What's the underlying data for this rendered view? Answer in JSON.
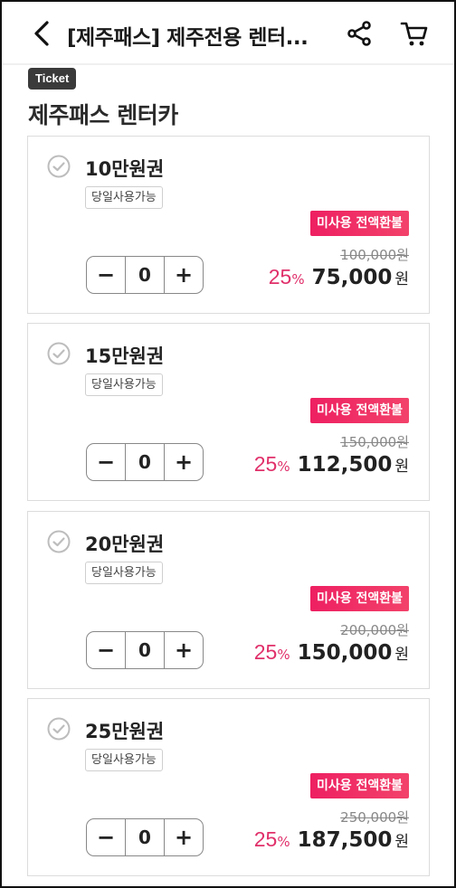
{
  "header": {
    "title": "[제주패스] 제주전용 렌터...",
    "back_icon": "chevron-left-icon",
    "share_icon": "share-icon",
    "cart_icon": "cart-icon"
  },
  "ticket_label": "Ticket",
  "section_title": "제주패스 렌터카",
  "products": [
    {
      "name": "10만원권",
      "tag": "당일사용가능",
      "refund_label": "미사용 전액환불",
      "original_price": "100,000원",
      "discount": "25",
      "percent": "%",
      "price": "75,000",
      "currency": "원",
      "quantity": "0"
    },
    {
      "name": "15만원권",
      "tag": "당일사용가능",
      "refund_label": "미사용 전액환불",
      "original_price": "150,000원",
      "discount": "25",
      "percent": "%",
      "price": "112,500",
      "currency": "원",
      "quantity": "0"
    },
    {
      "name": "20만원권",
      "tag": "당일사용가능",
      "refund_label": "미사용 전액환불",
      "original_price": "200,000원",
      "discount": "25",
      "percent": "%",
      "price": "150,000",
      "currency": "원",
      "quantity": "0"
    },
    {
      "name": "25만원권",
      "tag": "당일사용가능",
      "refund_label": "미사용 전액환불",
      "original_price": "250,000원",
      "discount": "25",
      "percent": "%",
      "price": "187,500",
      "currency": "원",
      "quantity": "0"
    }
  ],
  "stepper": {
    "minus": "−",
    "plus": "+"
  },
  "colors": {
    "accent": "#e0306a",
    "refund_badge": "#ee2062",
    "ticket_tag": "#3a3a3a"
  }
}
